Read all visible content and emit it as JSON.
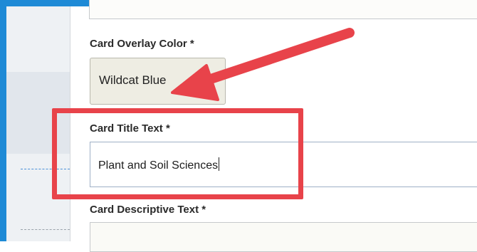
{
  "form": {
    "overlay_color": {
      "label": "Card Overlay Color *",
      "selected": "Wildcat Blue"
    },
    "title_text": {
      "label": "Card Title Text *",
      "value": "Plant and Soil Sciences"
    },
    "descriptive_text": {
      "label": "Card Descriptive Text *"
    }
  },
  "annotation": {
    "color": "#e8434a"
  },
  "colors": {
    "frame": "#1e8ad6",
    "sidebar": "#eef1f4"
  }
}
